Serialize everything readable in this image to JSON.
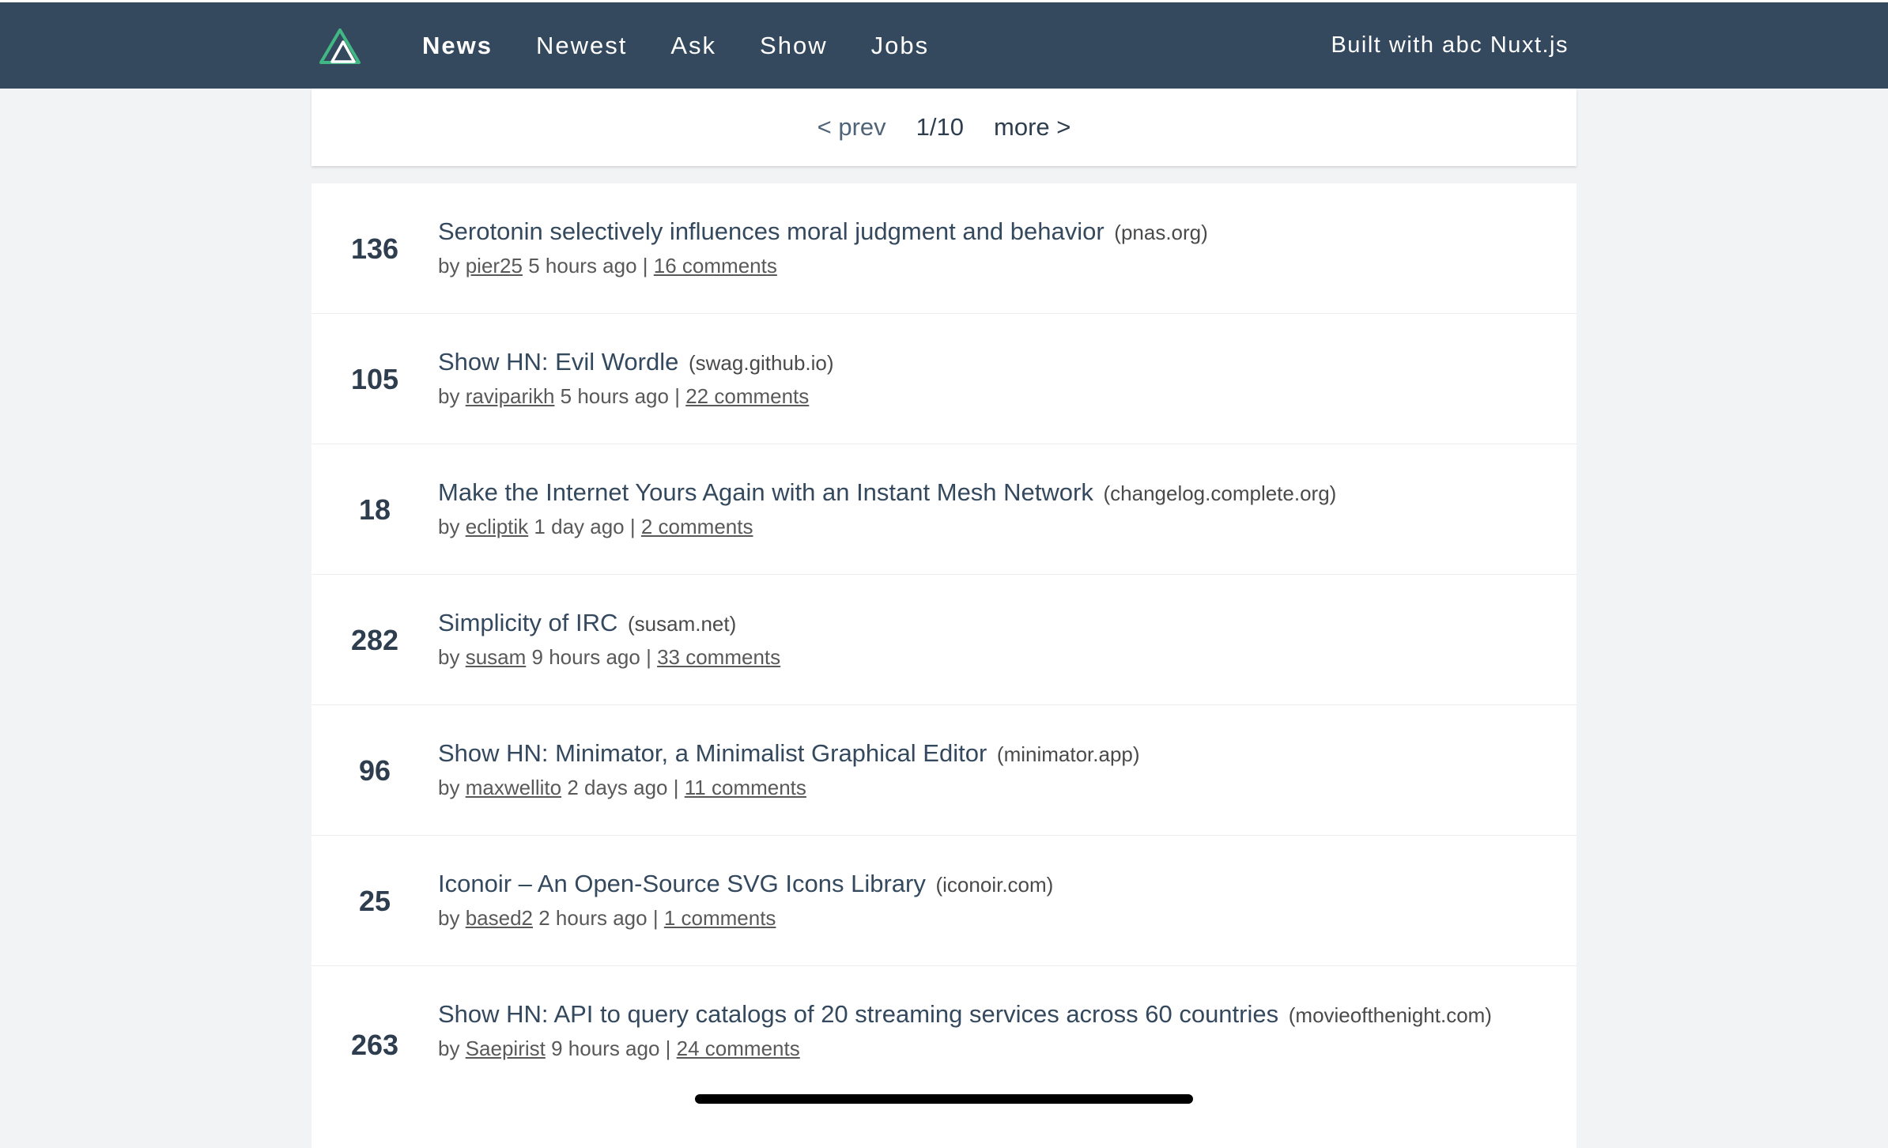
{
  "header": {
    "logo_icon": "nuxt-triangle-icon",
    "nav": [
      {
        "label": "News",
        "active": true
      },
      {
        "label": "Newest",
        "active": false
      },
      {
        "label": "Ask",
        "active": false
      },
      {
        "label": "Show",
        "active": false
      },
      {
        "label": "Jobs",
        "active": false
      }
    ],
    "built_with": "Built with abc Nuxt.js"
  },
  "pager": {
    "prev": "< prev",
    "count": "1/10",
    "more": "more >"
  },
  "items": [
    {
      "score": "136",
      "title": "Serotonin selectively influences moral judgment and behavior",
      "host": "(pnas.org)",
      "by": "by",
      "user": "pier25",
      "time": "5 hours ago",
      "sep": "|",
      "comments": "16 comments"
    },
    {
      "score": "105",
      "title": "Show HN: Evil Wordle",
      "host": "(swag.github.io)",
      "by": "by",
      "user": "raviparikh",
      "time": "5 hours ago",
      "sep": "|",
      "comments": "22 comments"
    },
    {
      "score": "18",
      "title": "Make the Internet Yours Again with an Instant Mesh Network",
      "host": "(changelog.complete.org)",
      "by": "by",
      "user": "ecliptik",
      "time": "1 day ago",
      "sep": "|",
      "comments": "2 comments"
    },
    {
      "score": "282",
      "title": "Simplicity of IRC",
      "host": "(susam.net)",
      "by": "by",
      "user": "susam",
      "time": "9 hours ago",
      "sep": "|",
      "comments": "33 comments"
    },
    {
      "score": "96",
      "title": "Show HN: Minimator, a Minimalist Graphical Editor",
      "host": "(minimator.app)",
      "by": "by",
      "user": "maxwellito",
      "time": "2 days ago",
      "sep": "|",
      "comments": "11 comments"
    },
    {
      "score": "25",
      "title": "Iconoir – An Open-Source SVG Icons Library",
      "host": "(iconoir.com)",
      "by": "by",
      "user": "based2",
      "time": "2 hours ago",
      "sep": "|",
      "comments": "1 comments"
    },
    {
      "score": "263",
      "title": "Show HN: API to query catalogs of 20 streaming services across 60 countries",
      "host": "(movieofthenight.com)",
      "by": "by",
      "user": "Saepirist",
      "time": "9 hours ago",
      "sep": "|",
      "comments": "24 comments"
    }
  ]
}
